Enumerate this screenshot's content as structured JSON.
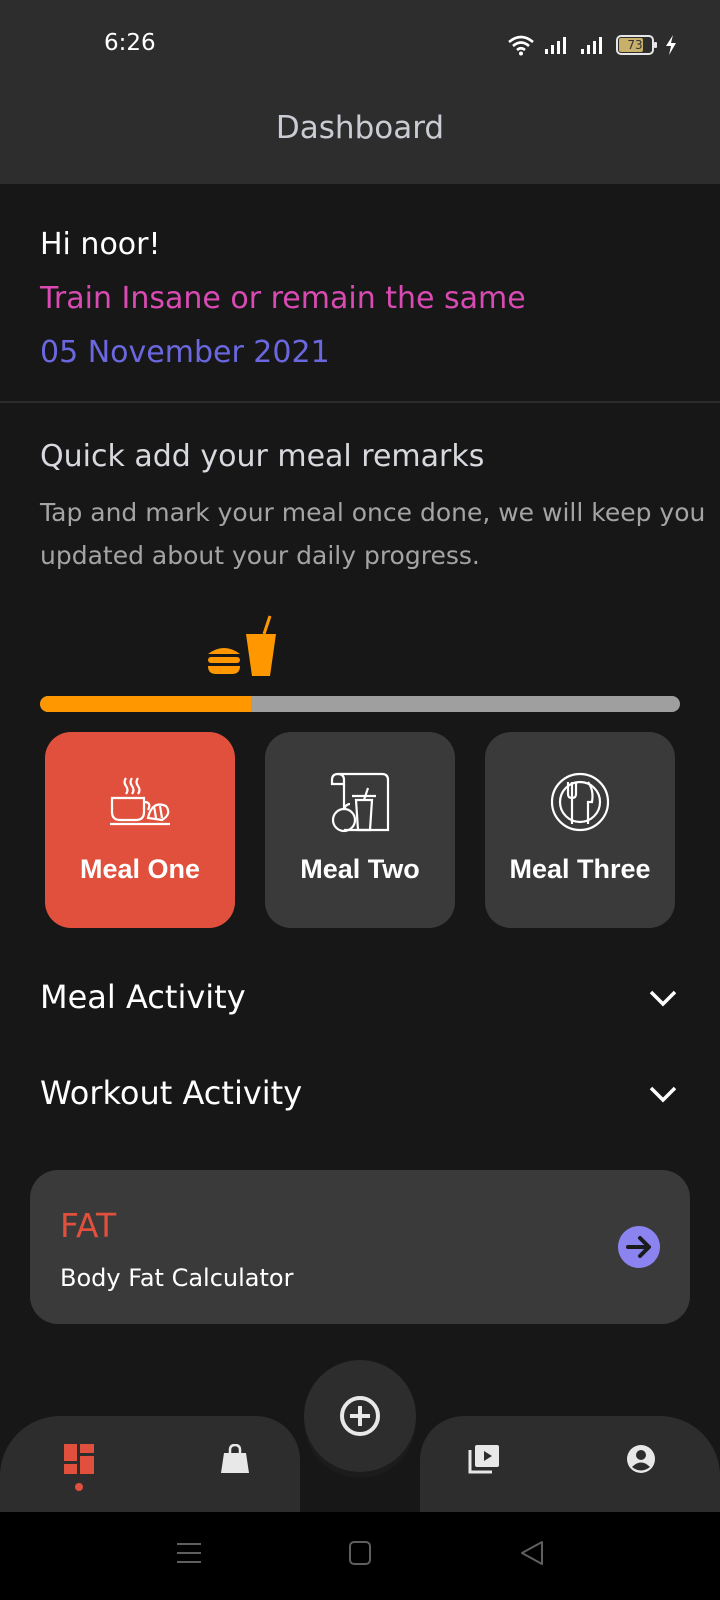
{
  "status_bar": {
    "time": "6:26",
    "battery_level": "73",
    "icons": [
      "wifi-icon",
      "signal-icon",
      "signal-icon",
      "battery-icon",
      "charging-icon"
    ]
  },
  "app_bar": {
    "title": "Dashboard"
  },
  "greeting": {
    "hello": "Hi noor!",
    "motto": "Train Insane or remain the same",
    "date": "05 November 2021"
  },
  "quick_add": {
    "title": "Quick add your meal remarks",
    "description": "Tap and mark your meal once done, we will keep you updated about your daily progress.",
    "progress_fraction": 0.33,
    "progress_icon": "burger-drink-icon"
  },
  "meals": [
    {
      "label": "Meal One",
      "icon": "breakfast-icon",
      "active": true
    },
    {
      "label": "Meal Two",
      "icon": "lunch-icon",
      "active": false
    },
    {
      "label": "Meal Three",
      "icon": "dinner-plate-icon",
      "active": false
    }
  ],
  "sections": {
    "meal_activity": "Meal Activity",
    "workout_activity": "Workout Activity"
  },
  "fat_card": {
    "title": "FAT",
    "subtitle": "Body Fat Calculator"
  },
  "bottom_nav": {
    "items": [
      "dashboard-icon",
      "shop-icon",
      "videos-icon",
      "profile-icon"
    ],
    "fab_icon": "plus-circle-icon",
    "active_index": 0
  },
  "colors": {
    "accent": "#e0503d",
    "motto": "#d94bb3",
    "date": "#6b68df",
    "progress": "#ff9800",
    "arrow": "#8a83f0"
  }
}
